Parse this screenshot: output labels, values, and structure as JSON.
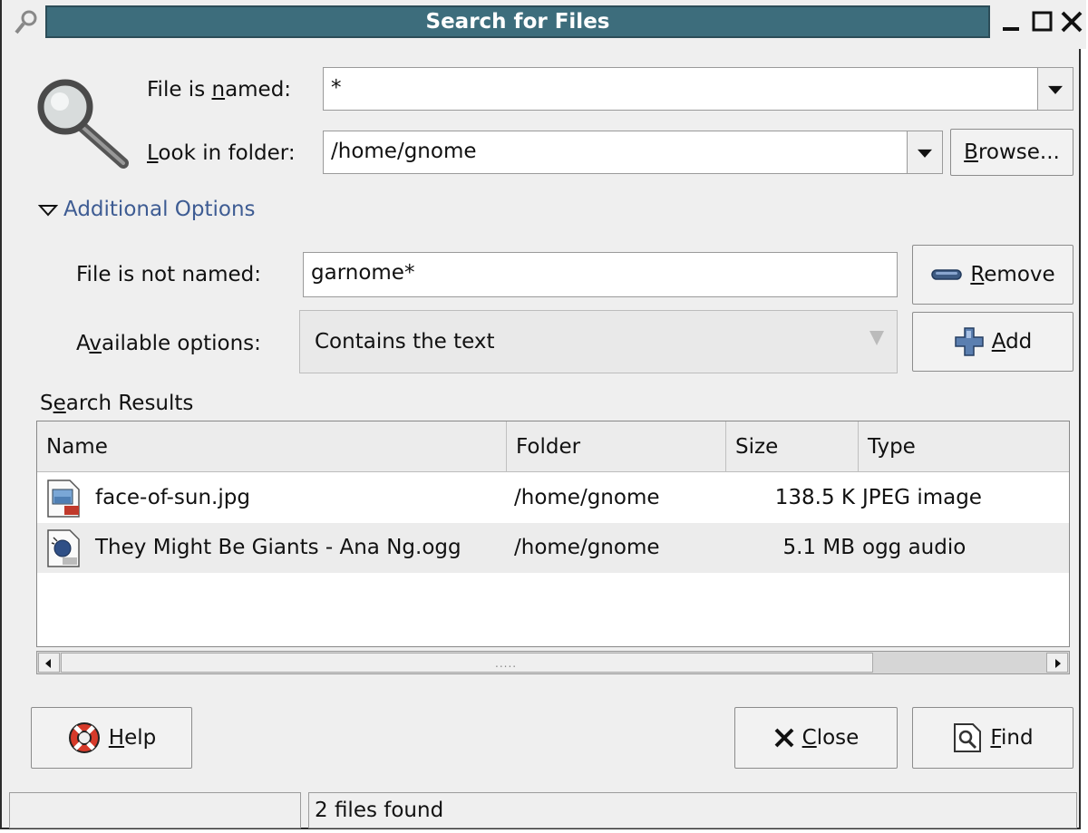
{
  "window": {
    "title": "Search for Files"
  },
  "form": {
    "named_label_pre": "File is ",
    "named_label_u": "n",
    "named_label_post": "amed:",
    "named_value": "*",
    "folder_label_u": "L",
    "folder_label_post": "ook in folder:",
    "folder_value": "/home/gnome",
    "browse_u": "B",
    "browse_post": "rowse..."
  },
  "options": {
    "expander_label": "Additional Options",
    "not_named_label": "File is not named:",
    "not_named_value": "garnome*",
    "remove_u": "R",
    "remove_post": "emove",
    "available_pre": "A",
    "available_u": "v",
    "available_post": "ailable options:",
    "available_value": "Contains the text",
    "add_u": "A",
    "add_post": "dd"
  },
  "results": {
    "label_pre": "S",
    "label_u": "e",
    "label_post": "arch Results",
    "columns": [
      "Name",
      "Folder",
      "Size",
      "Type"
    ],
    "rows": [
      {
        "name": "face-of-sun.jpg",
        "folder": "/home/gnome",
        "size": "138.5 K",
        "type": "JPEG image",
        "icon": "jpeg-file-icon"
      },
      {
        "name": "They Might Be Giants - Ana Ng.ogg",
        "folder": "/home/gnome",
        "size": "5.1 MB",
        "type": "ogg audio",
        "icon": "audio-file-icon"
      }
    ],
    "grip": "....."
  },
  "buttons": {
    "help_u": "H",
    "help_post": "elp",
    "close_u": "C",
    "close_post": "lose",
    "find_u": "F",
    "find_post": "ind"
  },
  "status": {
    "left": "",
    "message": "2 files found"
  },
  "colors": {
    "titlebar": "#3d6d7c",
    "link": "#3e5c93",
    "background": "#efefef"
  }
}
